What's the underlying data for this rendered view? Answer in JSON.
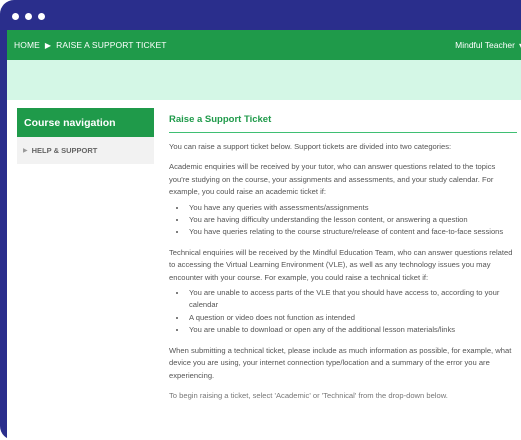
{
  "breadcrumb": {
    "home": "HOME",
    "current": "RAISE A SUPPORT TICKET"
  },
  "user": {
    "name": "Mindful Teacher"
  },
  "sidebar": {
    "heading": "Course navigation",
    "items": [
      {
        "label": "HELP & SUPPORT"
      }
    ]
  },
  "main": {
    "title": "Raise a Support Ticket",
    "intro": "You can raise a support ticket below. Support tickets are divided into two categories:",
    "academic_text": "Academic enquiries will be received by your tutor, who can answer questions related to the topics you're studying on the course, your assignments and assessments, and your study calendar. For example, you could raise an academic ticket if:",
    "academic_items": [
      "You have any queries with assessments/assignments",
      "You are having difficulty understanding the lesson content, or answering a question",
      "You have queries relating to the course structure/release of content and face-to-face sessions"
    ],
    "technical_text": "Technical enquiries will be received by the Mindful Education Team, who can answer questions related to accessing the Virtual Learning Environment (VLE), as well as any technology issues you may encounter with your course. For example, you could raise a technical ticket if:",
    "technical_items": [
      "You are unable to access parts of the VLE that you should have access to, according to your calendar",
      "A question or video does not function as intended",
      "You are unable to download or open any of the additional lesson materials/links"
    ],
    "submit_text": "When submitting a technical ticket, please include as much information as possible, for example, what device you are using, your internet connection type/location and a summary of the error you are experiencing.",
    "begin_text": "To begin raising a ticket, select 'Academic' or 'Technical' from the drop-down below."
  },
  "colors": {
    "frame": "#2a2e8c",
    "accent": "#1f9a4a",
    "banner": "#d4f7e6"
  }
}
